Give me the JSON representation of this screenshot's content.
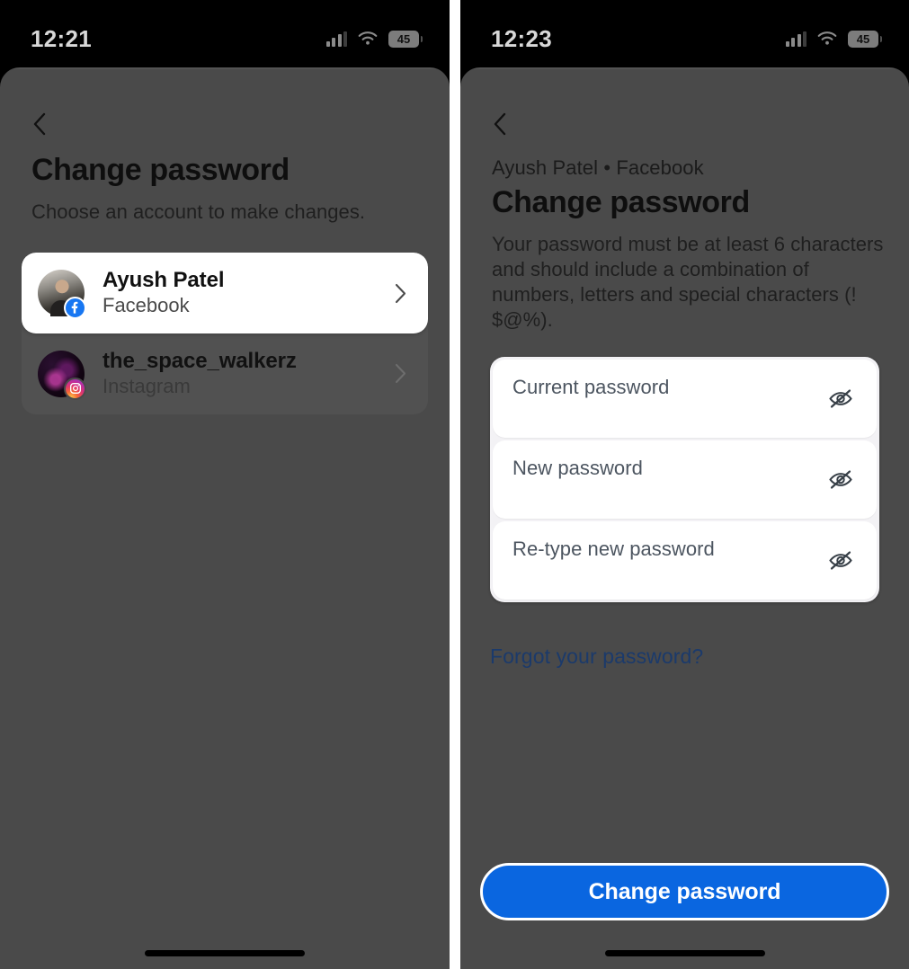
{
  "left_screen": {
    "status_bar": {
      "time": "12:21",
      "signal_icon": "cellular-bars-icon",
      "wifi_icon": "wifi-icon",
      "battery_level": "45"
    },
    "back_icon": "chevron-left-icon",
    "title": "Change password",
    "subtitle": "Choose an account to make changes.",
    "accounts": [
      {
        "name": "Ayush Patel",
        "platform": "Facebook",
        "badge_icon": "facebook-badge-icon",
        "avatar_icon": "profile-photo-avatar",
        "chevron_icon": "chevron-right-icon",
        "selected": true
      },
      {
        "name": "the_space_walkerz",
        "platform": "Instagram",
        "badge_icon": "instagram-badge-icon",
        "avatar_icon": "profile-photo-avatar",
        "chevron_icon": "chevron-right-icon",
        "selected": false
      }
    ],
    "home_indicator": "home-indicator"
  },
  "right_screen": {
    "status_bar": {
      "time": "12:23",
      "signal_icon": "cellular-bars-icon",
      "wifi_icon": "wifi-icon",
      "battery_level": "45"
    },
    "back_icon": "chevron-left-icon",
    "eyebrow": "Ayush Patel • Facebook",
    "title": "Change password",
    "description": "Your password must be at least 6 characters and should include a combination of numbers, letters and special characters (! $@%).",
    "fields": [
      {
        "placeholder": "Current password",
        "value": "",
        "toggle_icon": "eye-slash-icon"
      },
      {
        "placeholder": "New password",
        "value": "",
        "toggle_icon": "eye-slash-icon"
      },
      {
        "placeholder": "Re-type new password",
        "value": "",
        "toggle_icon": "eye-slash-icon"
      }
    ],
    "forgot_link": "Forgot your password?",
    "submit_label": "Change password",
    "home_indicator": "home-indicator"
  },
  "colors": {
    "accent_blue": "#0a66e0",
    "sheet_bg": "#4a4a4a",
    "link_blue": "#1b3a6b",
    "facebook_blue": "#1877f2"
  }
}
